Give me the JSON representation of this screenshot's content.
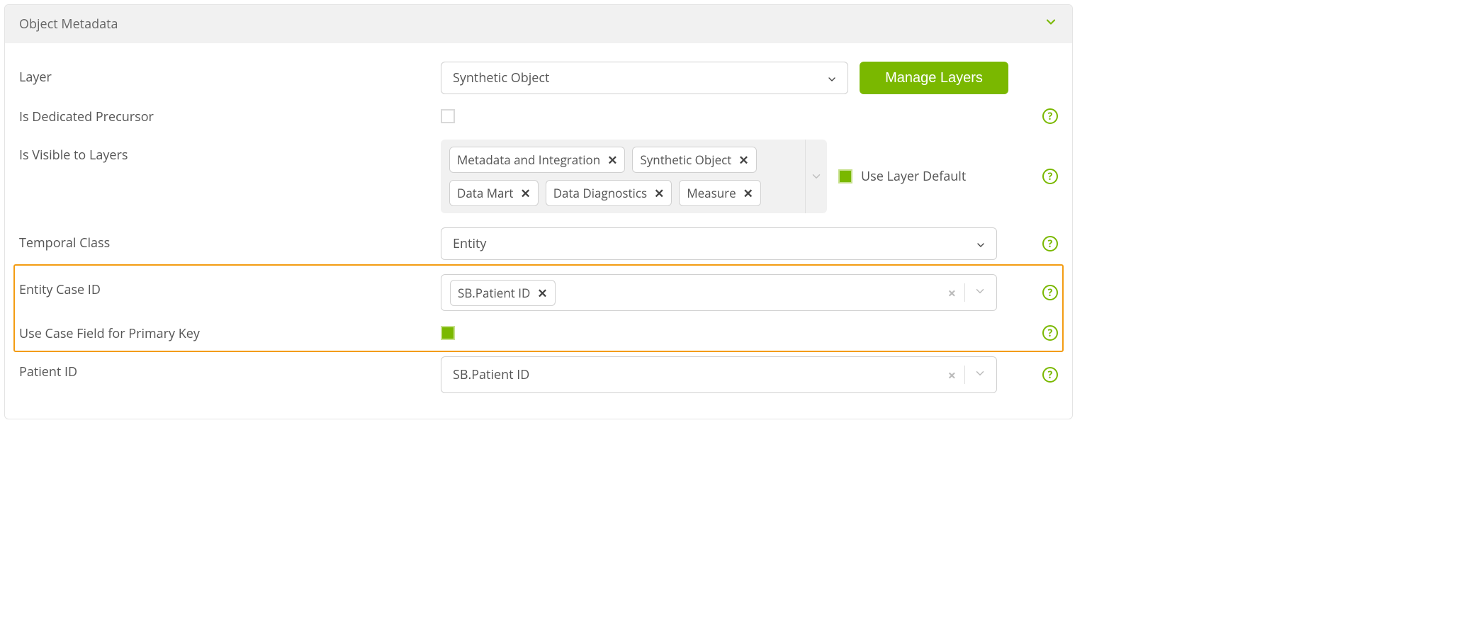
{
  "panel": {
    "title": "Object Metadata"
  },
  "layer": {
    "label": "Layer",
    "value": "Synthetic Object",
    "manage_btn": "Manage Layers"
  },
  "precursor": {
    "label": "Is Dedicated Precursor",
    "checked": false
  },
  "visible": {
    "label": "Is Visible to Layers",
    "tags": [
      "Metadata and Integration",
      "Synthetic Object",
      "Data Mart",
      "Data Diagnostics",
      "Measure"
    ],
    "use_default_label": "Use Layer Default",
    "use_default_checked": true
  },
  "temporal": {
    "label": "Temporal Class",
    "value": "Entity"
  },
  "entity_case": {
    "label": "Entity Case ID",
    "token": "SB.Patient ID"
  },
  "use_case_pk": {
    "label": "Use Case Field for Primary Key",
    "checked": true
  },
  "patient_id": {
    "label": "Patient ID",
    "value": "SB.Patient ID"
  }
}
